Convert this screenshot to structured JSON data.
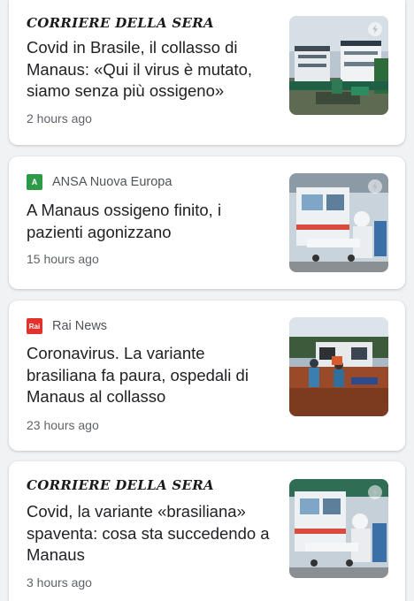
{
  "feed": {
    "articles": [
      {
        "source": "CORRIERE DELLA SERA",
        "source_style": "masthead",
        "headline": "Covid in Brasile, il collasso di Manaus: «Qui il virus è mutato, siamo senza più ossigeno»",
        "time": "2 hours ago",
        "thumbnail_icon": "amp-lightning-icon"
      },
      {
        "source": "ANSA Nuova Europa",
        "source_style": "logo",
        "logo_text": "A",
        "logo_color": "#2d9a47",
        "headline": "A Manaus ossigeno finito, i pazienti agonizzano",
        "time": "15 hours ago",
        "thumbnail_icon": "amp-lightning-icon"
      },
      {
        "source": "Rai News",
        "source_style": "logo",
        "logo_text": "Rai",
        "logo_color": "#e2322b",
        "headline": "Coronavirus. La variante brasiliana fa paura, ospedali di Manaus al collasso",
        "time": "23 hours ago",
        "thumbnail_icon": "none"
      },
      {
        "source": "CORRIERE DELLA SERA",
        "source_style": "masthead",
        "headline": "Covid, la variante «brasiliana» spaventa: cosa sta succedendo a Manaus",
        "time": "3 hours ago",
        "thumbnail_icon": "amp-lightning-icon"
      }
    ]
  }
}
